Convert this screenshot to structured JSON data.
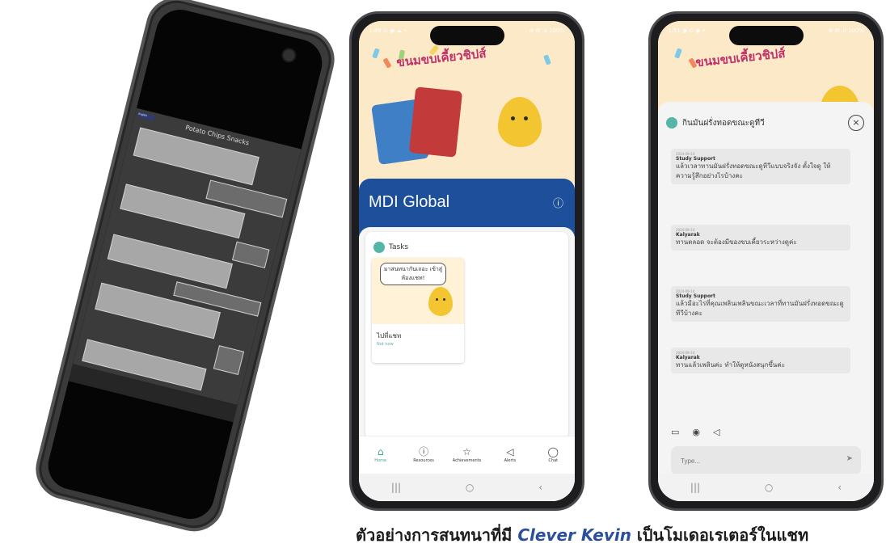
{
  "phone1": {
    "chat_title": "Potato Chips Snacks",
    "tag": "English"
  },
  "phone2": {
    "status_left": "1:49 ⊙ ◉ ☁ •",
    "status_right": "⊕ ✉ .ıl 100%",
    "banner_title": "ขนมขบเคี้ยวชิปส์",
    "org_name": "MDI Global",
    "tasks_label": "Tasks",
    "task_card": {
      "bubble_text": "มาสนทนากันเถอะ เข้าสู่ห้องแชท!",
      "caption": "ไปที่แชท",
      "sub": "Not now"
    },
    "tabs": [
      {
        "label": "Home",
        "icon": "home-icon"
      },
      {
        "label": "Resources",
        "icon": "info-icon"
      },
      {
        "label": "Achievements",
        "icon": "star-icon"
      },
      {
        "label": "Alerts",
        "icon": "megaphone-icon"
      },
      {
        "label": "Chat",
        "icon": "chat-icon"
      }
    ],
    "sysnav": [
      "|||",
      "○",
      "‹"
    ]
  },
  "phone3": {
    "status_left": "1:51 ◉ ⊙ ◉ •",
    "status_right": "⊕ ✉ .ıl 100%",
    "banner_title": "ขนมขบเคี้ยวชิปส์",
    "chat_title": "กินมันฝรั่งทอดขณะดูทีวี",
    "messages": [
      {
        "date": "2024-09-14",
        "sender": "Study Support",
        "text": "แล้วเวลาทานมันฝรั่งทอดขณะดูทีวีแบบจริงจัง ตั้งใจดู ให้ความรู้สึกอย่างไรบ้างคะ"
      },
      {
        "date": "2024-09-14",
        "sender": "Kalyarak",
        "text": "ทานตลอด จะต้องมีของขบเคี้ยวระหว่างดูค่ะ"
      },
      {
        "date": "2024-09-14",
        "sender": "Study Support",
        "text": "แล้วมีอะไรที่คุณเพลินเพลินขณะเวลาที่ทานมันฝรั่งทอดขณะดูทีวีบ้างคะ"
      },
      {
        "date": "2024-09-14",
        "sender": "Kalyarak",
        "text": "ทานแล้วเพลินค่ะ ทำให้ดูหนังสนุกขึ้นค่ะ"
      }
    ],
    "input_placeholder": "Type...",
    "sysnav": [
      "|||",
      "○",
      "‹"
    ]
  },
  "caption": {
    "prefix": "ตัวอย่างการสนทนาที่มี ",
    "em": "Clever Kevin",
    "suffix": " เป็นโมเดอเรเตอร์ในแชท"
  },
  "colors": {
    "brand_blue": "#1e4f9a",
    "accent_teal": "#3aa88f",
    "banner_pink": "#c0316b"
  }
}
